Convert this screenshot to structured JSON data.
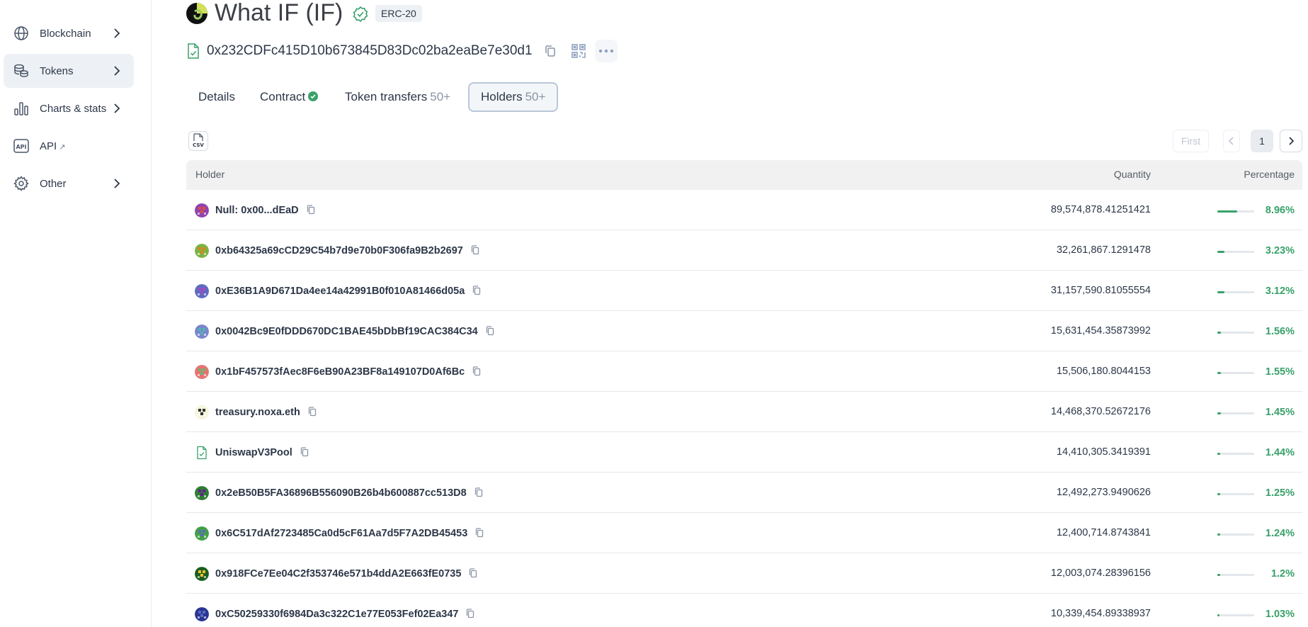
{
  "sidebar": {
    "items": [
      {
        "label": "Blockchain",
        "icon": "globe-icon",
        "has_chevron": true
      },
      {
        "label": "Tokens",
        "icon": "coins-icon",
        "has_chevron": true,
        "active": true
      },
      {
        "label": "Charts & stats",
        "icon": "bar-chart-icon",
        "has_chevron": true
      },
      {
        "label": "API",
        "icon": "api-icon",
        "external": "↗"
      },
      {
        "label": "Other",
        "icon": "gear-icon",
        "has_chevron": true
      }
    ]
  },
  "header": {
    "title": "What IF (IF)",
    "badge": "ERC-20",
    "address": "0x232CDFc415D10b673845D83Dc02ba2eaBe7e30d1"
  },
  "tabs": [
    {
      "label": "Details",
      "count": ""
    },
    {
      "label": "Contract",
      "count": ""
    },
    {
      "label": "Token transfers",
      "count": "50+"
    },
    {
      "label": "Holders",
      "count": "50+",
      "active": true
    }
  ],
  "pagination": {
    "first": "First",
    "page": "1"
  },
  "table": {
    "headers": {
      "holder": "Holder",
      "quantity": "Quantity",
      "percentage": "Percentage"
    },
    "rows": [
      {
        "holder": "Null: 0x00...dEaD",
        "quantity": "89,574,878.41251421",
        "percentage": "8.96%",
        "share": 0.0896,
        "avatar": [
          "#8e44ad",
          "#e74c3c"
        ]
      },
      {
        "holder": "0xb64325a69cCD29C54b7d9e70b0F306fa9B2b2697",
        "quantity": "32,261,867.1291478",
        "percentage": "3.23%",
        "share": 0.0323,
        "avatar": [
          "#7cb342",
          "#e67e22"
        ]
      },
      {
        "holder": "0xE36B1A9D671Da4ee14a42991B0f010A81466d05a",
        "quantity": "31,157,590.81055554",
        "percentage": "3.12%",
        "share": 0.0312,
        "avatar": [
          "#5c6bc0",
          "#ab47bc"
        ]
      },
      {
        "holder": "0x0042Bc9E0fDDD670DC1BAE45bDbBf19CAC384C34",
        "quantity": "15,631,454.35873992",
        "percentage": "1.56%",
        "share": 0.0156,
        "avatar": [
          "#7986cb",
          "#4db6ac"
        ]
      },
      {
        "holder": "0x1bF457573fAec8F6eB90A23BF8a149107D0Af6Bc",
        "quantity": "15,506,180.8044153",
        "percentage": "1.55%",
        "share": 0.0155,
        "avatar": [
          "#e57373",
          "#66bb6a"
        ]
      },
      {
        "holder": "treasury.noxa.eth",
        "quantity": "14,468,370.52672176",
        "percentage": "1.45%",
        "share": 0.0145,
        "avatar": [
          "#f5f5dc",
          "#333333"
        ]
      },
      {
        "holder": "UniswapV3Pool",
        "quantity": "14,410,305.3419391",
        "percentage": "1.44%",
        "share": 0.0144,
        "avatar": [
          "contract",
          "contract"
        ]
      },
      {
        "holder": "0x2eB50B5FA36896B556090B26b4b600887cc513D8",
        "quantity": "12,492,273.9490626",
        "percentage": "1.25%",
        "share": 0.0125,
        "avatar": [
          "#2e7d32",
          "#6a1b9a"
        ]
      },
      {
        "holder": "0x6C517dAf2723485Ca0d5cF61Aa7d5F7A2DB45453",
        "quantity": "12,400,714.8743841",
        "percentage": "1.24%",
        "share": 0.0124,
        "avatar": [
          "#43a047",
          "#5c6bc0"
        ]
      },
      {
        "holder": "0x918FCe7Ee04C2f353746e571b4ddA2E663fE0735",
        "quantity": "12,003,074.28396156",
        "percentage": "1.2%",
        "share": 0.012,
        "avatar": [
          "#1b5e20",
          "#fbc02d"
        ]
      },
      {
        "holder": "0xC50259330f6984Da3c322C1e77E053Fef02Ea347",
        "quantity": "10,339,454.89338937",
        "percentage": "1.03%",
        "share": 0.0103,
        "avatar": [
          "#283593",
          "#5c6bc0"
        ]
      }
    ]
  },
  "colors": {
    "accent_green": "#38a169",
    "active_bg": "#edf1f5",
    "tab_border": "#b8c7d9"
  }
}
